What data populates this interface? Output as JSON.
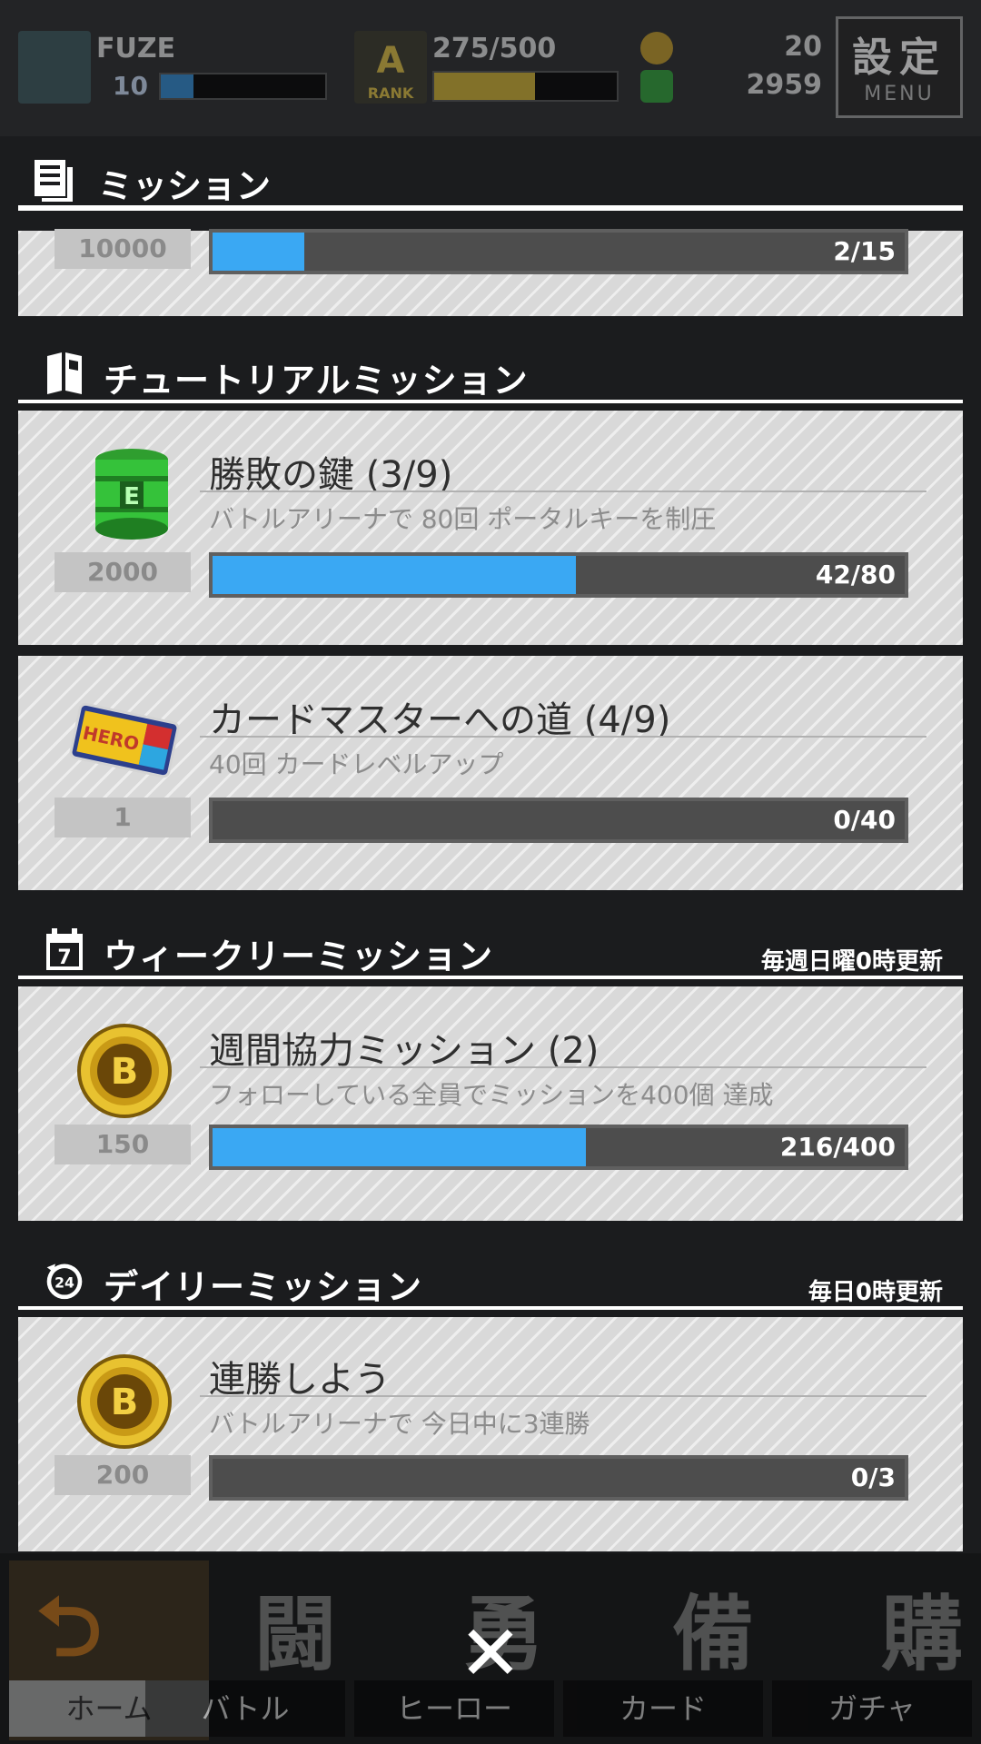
{
  "topbar": {
    "player_name": "FUZE",
    "level": "10",
    "level_progress": 0.2,
    "rank_label": "RANK",
    "rank_value": "275/500",
    "rank_progress": 0.55,
    "gold_value": "20",
    "key_value": "2959",
    "menu_kanji": "設定",
    "menu_label": "MENU"
  },
  "modal": {
    "title": "ミッション",
    "partial_item": {
      "reward": "10000",
      "progress_text": "2/15",
      "progress": 0.1333
    }
  },
  "sections": [
    {
      "title": "チュートリアルミッション",
      "note": "",
      "items": [
        {
          "icon": "green-key-barrel-icon",
          "reward": "2000",
          "title": "勝敗の鍵 (3/9)",
          "desc": "バトルアリーナで 80回 ポータルキーを制圧",
          "progress_text": "42/80",
          "progress": 0.525
        },
        {
          "icon": "hero-ticket-icon",
          "reward": "1",
          "title": "カードマスターへの道 (4/9)",
          "desc": "40回 カードレベルアップ",
          "progress_text": "0/40",
          "progress": 0
        }
      ]
    },
    {
      "title": "ウィークリーミッション",
      "note": "毎週日曜0時更新",
      "items": [
        {
          "icon": "gold-coin-icon",
          "reward": "150",
          "title": "週間協力ミッション (2)",
          "desc": "フォローしている全員でミッションを400個 達成",
          "progress_text": "216/400",
          "progress": 0.54
        }
      ]
    },
    {
      "title": "デイリーミッション",
      "note": "毎日0時更新",
      "items": [
        {
          "icon": "gold-coin-icon",
          "reward": "200",
          "title": "連勝しよう",
          "desc": "バトルアリーナで 今日中に3連勝",
          "progress_text": "0/3",
          "progress": 0
        }
      ]
    }
  ],
  "bottomnav": [
    {
      "kanji": "",
      "label": "ホーム"
    },
    {
      "kanji": "闘",
      "label": "バトル"
    },
    {
      "kanji": "勇",
      "label": "ヒーロー"
    },
    {
      "kanji": "備",
      "label": "カード"
    },
    {
      "kanji": "購",
      "label": "ガチャ"
    }
  ],
  "close_glyph": "✕",
  "colors": {
    "progress_fill": "#3aa8f3",
    "panel_bg": "#d9d9d9",
    "gold": "#e5c545"
  }
}
